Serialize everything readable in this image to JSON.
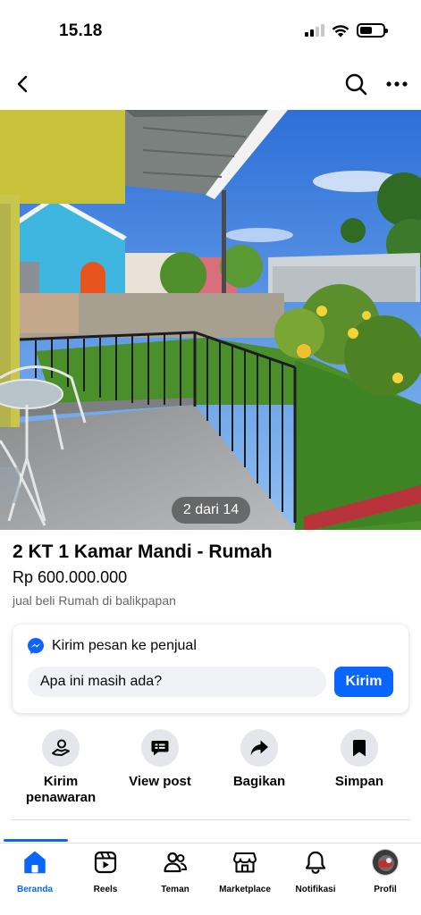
{
  "status_bar": {
    "time": "15.18"
  },
  "top_nav": {
    "back_icon": "chevron-left-icon",
    "search_icon": "search-icon",
    "more_icon": "more-horizontal-icon"
  },
  "photo": {
    "counter": "2 dari 14",
    "current_index": 2,
    "total": 14
  },
  "listing": {
    "title": "2 KT 1 Kamar Mandi - Rumah",
    "price": "Rp 600.000.000",
    "location": "jual beli Rumah di balikpapan"
  },
  "message": {
    "header": "Kirim pesan ke penjual",
    "input_value": "Apa ini masih ada?",
    "send_label": "Kirim",
    "icon": "messenger-icon"
  },
  "actions": [
    {
      "label": "Kirim penawaran",
      "icon": "offer-icon"
    },
    {
      "label": "View post",
      "icon": "view-post-icon"
    },
    {
      "label": "Bagikan",
      "icon": "share-icon"
    },
    {
      "label": "Simpan",
      "icon": "bookmark-icon"
    }
  ],
  "tabs": [
    {
      "label": "Beranda",
      "icon": "home-icon",
      "active": true
    },
    {
      "label": "Reels",
      "icon": "reels-icon",
      "active": false
    },
    {
      "label": "Teman",
      "icon": "friends-icon",
      "active": false
    },
    {
      "label": "Marketplace",
      "icon": "marketplace-icon",
      "active": false
    },
    {
      "label": "Notifikasi",
      "icon": "bell-icon",
      "active": false
    },
    {
      "label": "Profil",
      "icon": "avatar",
      "active": false
    }
  ],
  "colors": {
    "accent": "#0866ff",
    "secondary_text": "#65676b",
    "button_grey": "#e4e6eb"
  }
}
